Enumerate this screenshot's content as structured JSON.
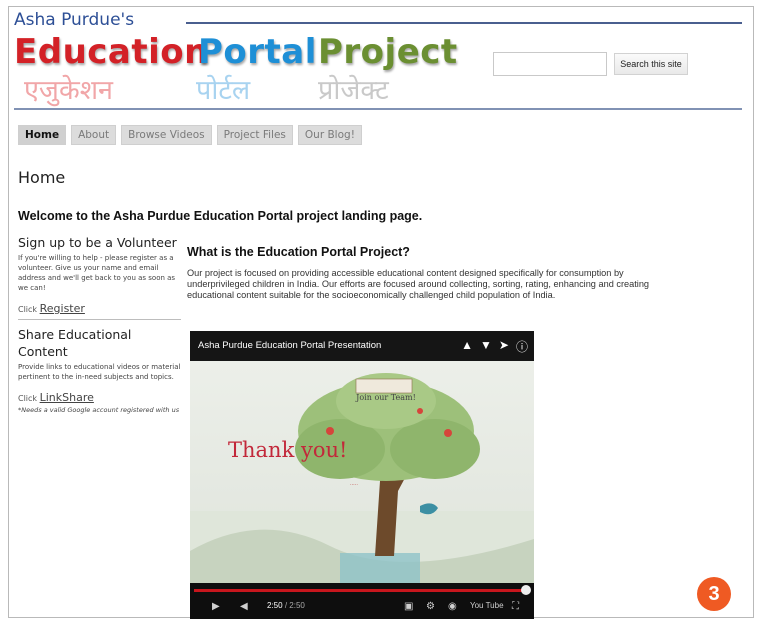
{
  "header": {
    "owner": "Asha Purdue's",
    "logo_words": [
      "Education",
      "Portal",
      "Project"
    ],
    "logo_hindi": [
      "एजुकेशन",
      "पोर्टल",
      "प्रोजेक्ट"
    ],
    "search_placeholder": "",
    "search_button": "Search this site"
  },
  "nav": {
    "tabs": [
      "Home",
      "About",
      "Browse Videos",
      "Project Files",
      "Our Blog!"
    ],
    "active": "Home"
  },
  "page": {
    "title": "Home",
    "welcome": "Welcome to the Asha Purdue Education Portal project landing page."
  },
  "sidebar": {
    "volunteer_title": "Sign up to be a Volunteer",
    "volunteer_text": "If you're willing to help - please register as a volunteer. Give us your name and email address and we'll get back to you as soon as we can!",
    "click_label": "Click",
    "register_link": "Register",
    "share_title": "Share Educational Content",
    "share_text": "Provide links to educational videos or material pertinent to the in-need subjects and topics.",
    "linkshare_link": "LinkShare",
    "note": "*Needs a valid Google account registered with us"
  },
  "main": {
    "question": "What is the Education Portal Project?",
    "body": "Our project is focused on providing accessible educational content designed specifically for consumption by underprivileged children in India. Our efforts are focused around collecting, sorting, rating, enhancing and creating educational content suitable for the socioeconomically challenged child population of India."
  },
  "video": {
    "title": "Asha Purdue Education Portal Presentation",
    "slide_text": "Thank you!",
    "slide_caption": "Join our Team!",
    "progress": 1.0,
    "time_current": "2:50",
    "time_total": "2:50",
    "yt_label": "You Tube"
  },
  "badge": {
    "number": "3",
    "color": "#ef5a23"
  },
  "colors": {
    "education": "#d32127",
    "portal": "#1e8fd6",
    "project": "#6b8f32",
    "heading_blue": "#2d4f96"
  }
}
